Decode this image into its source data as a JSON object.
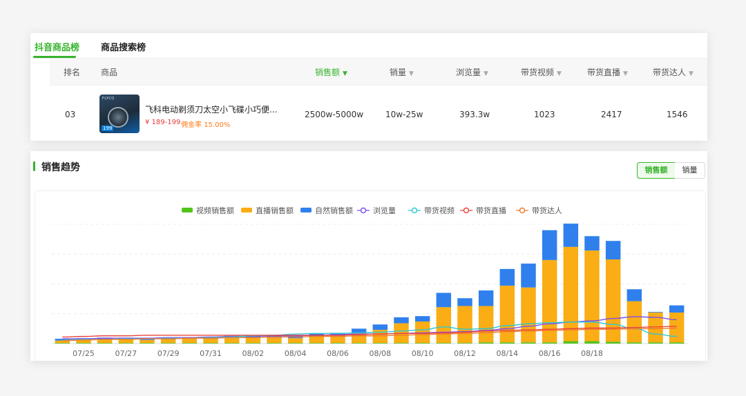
{
  "tabs": [
    {
      "label": "抖音商品榜",
      "active": true
    },
    {
      "label": "商品搜索榜",
      "active": false
    }
  ],
  "table": {
    "headers": [
      {
        "label": "排名",
        "sortable": false
      },
      {
        "label": "商品",
        "sortable": false
      },
      {
        "label": "销售额",
        "sortable": true,
        "sorted": true
      },
      {
        "label": "销量",
        "sortable": true
      },
      {
        "label": "浏览量",
        "sortable": true
      },
      {
        "label": "带货视频",
        "sortable": true
      },
      {
        "label": "带货直播",
        "sortable": true
      },
      {
        "label": "带货达人",
        "sortable": true
      }
    ],
    "row": {
      "rank": "03",
      "product_name": "飞科电动剃须刀太空小飞碟小巧便...",
      "price": "¥ 189-199",
      "commission": "佣金率 15.00%",
      "thumb_brand": "FLYCO",
      "thumb_price": "199",
      "sales_amount": "2500w-5000w",
      "sales_volume": "10w-25w",
      "views": "393.3w",
      "videos": "1023",
      "lives": "2417",
      "influencers": "1546"
    }
  },
  "trend": {
    "title": "销售趋势",
    "toggles": [
      {
        "label": "销售额",
        "active": true
      },
      {
        "label": "销量",
        "active": false
      }
    ]
  },
  "colors": {
    "accent": "#36b42d",
    "video_sales": "#52c41a",
    "live_sales": "#faad14",
    "natural_sales": "#2f80ed",
    "views": "#7b4ff0",
    "videos": "#2cc7d6",
    "lives": "#e8453c",
    "influencers": "#f07a2c"
  },
  "chart_data": {
    "type": "bar",
    "stacked": true,
    "grid": true,
    "legend_position": "top",
    "x_tick_labels": [
      "07/25",
      "07/27",
      "07/29",
      "07/31",
      "08/02",
      "08/04",
      "08/06",
      "08/08",
      "08/10",
      "08/12",
      "08/14",
      "08/16",
      "08/18"
    ],
    "categories": [
      "07/24",
      "07/25",
      "07/26",
      "07/27",
      "07/28",
      "07/29",
      "07/30",
      "07/31",
      "08/01",
      "08/02",
      "08/03",
      "08/04",
      "08/05",
      "08/06",
      "08/07",
      "08/08",
      "08/09",
      "08/10",
      "08/11",
      "08/12",
      "08/13",
      "08/14",
      "08/15",
      "08/16",
      "08/17",
      "08/18",
      "08/19",
      "08/20",
      "08/21",
      "08/22"
    ],
    "ylim": [
      0,
      200
    ],
    "series": [
      {
        "name": "视频销售额",
        "kind": "bar",
        "values": [
          1,
          1,
          1,
          1,
          1,
          1,
          1,
          1,
          1,
          1,
          1,
          1,
          1,
          1,
          1,
          1,
          1,
          1,
          1,
          1,
          2,
          2,
          2,
          2,
          4,
          4,
          3,
          2,
          2,
          2
        ]
      },
      {
        "name": "直播销售额",
        "kind": "bar",
        "values": [
          4,
          5,
          6,
          7,
          5,
          6,
          7,
          7,
          8,
          9,
          9,
          8,
          11,
          12,
          17,
          22,
          33,
          36,
          60,
          62,
          61,
          95,
          92,
          138,
          158,
          152,
          138,
          69,
          50,
          50
        ]
      },
      {
        "name": "自然销售额",
        "kind": "bar",
        "values": [
          3,
          3,
          3,
          2,
          2,
          2,
          2,
          3,
          4,
          4,
          4,
          4,
          5,
          5,
          7,
          9,
          10,
          9,
          24,
          13,
          26,
          28,
          40,
          50,
          39,
          24,
          31,
          20,
          1,
          12
        ]
      },
      {
        "name": "浏览量",
        "kind": "line",
        "values": [
          8,
          8,
          9,
          9,
          9,
          10,
          10,
          11,
          12,
          12,
          13,
          13,
          14,
          15,
          16,
          16,
          17,
          18,
          19,
          20,
          22,
          25,
          29,
          33,
          36,
          38,
          42,
          45,
          44,
          40
        ]
      },
      {
        "name": "带货视频",
        "kind": "line",
        "values": [
          6,
          7,
          7,
          8,
          8,
          9,
          9,
          10,
          11,
          13,
          14,
          16,
          17,
          17,
          18,
          19,
          21,
          23,
          28,
          24,
          25,
          30,
          33,
          35,
          36,
          36,
          32,
          25,
          16,
          12
        ]
      },
      {
        "name": "带货直播",
        "kind": "line",
        "values": [
          11,
          12,
          13,
          13,
          14,
          14,
          14,
          14,
          14,
          14,
          14,
          14,
          14,
          14,
          15,
          16,
          17,
          17,
          18,
          19,
          21,
          22,
          23,
          24,
          25,
          26,
          26,
          27,
          28,
          29
        ]
      },
      {
        "name": "带货达人",
        "kind": "line",
        "values": [
          5,
          6,
          7,
          7,
          8,
          8,
          9,
          9,
          10,
          10,
          11,
          11,
          12,
          12,
          13,
          13,
          14,
          15,
          16,
          17,
          18,
          20,
          21,
          22,
          23,
          24,
          24,
          25,
          25,
          26
        ]
      }
    ]
  }
}
